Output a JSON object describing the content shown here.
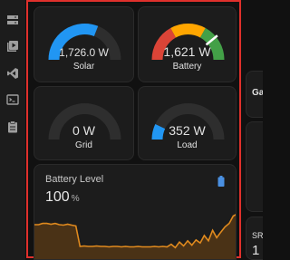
{
  "sidebar": {
    "icons": [
      "storage-icon",
      "media-icon",
      "vscode-icon",
      "terminal-icon",
      "clipboard-icon"
    ]
  },
  "gauges": [
    {
      "name": "Solar",
      "value": "1,726.0 W",
      "fraction": 0.62,
      "color": "#2196f3"
    },
    {
      "name": "Battery",
      "value": "1,621 W",
      "fraction": 0.78,
      "color": "#ffffff"
    },
    {
      "name": "Grid",
      "value": "0 W",
      "fraction": 0.0,
      "color": "#2196f3"
    },
    {
      "name": "Load",
      "value": "352 W",
      "fraction": 0.14,
      "color": "#2196f3"
    }
  ],
  "battery_level": {
    "title": "Battery Level",
    "value": "100",
    "unit": "%",
    "accent_color": "#e08a1e",
    "series": [
      75,
      75,
      78,
      78,
      76,
      78,
      75,
      74,
      76,
      74,
      72,
      25,
      26,
      25,
      25,
      26,
      25,
      25,
      24,
      25,
      25,
      24,
      25,
      24,
      24,
      25,
      24,
      24,
      24,
      25,
      24,
      25,
      24,
      30,
      22,
      35,
      26,
      38,
      28,
      40,
      33,
      50,
      38,
      62,
      45,
      58,
      70,
      78,
      95,
      100
    ]
  },
  "right_panel": {
    "top_text": "Ga",
    "bottom_label": "SR",
    "bottom_value": "1"
  },
  "colors": {
    "highlight_border": "#e0302c",
    "battery_segments": [
      "#db4437",
      "#ffa600",
      "#43a047"
    ]
  }
}
